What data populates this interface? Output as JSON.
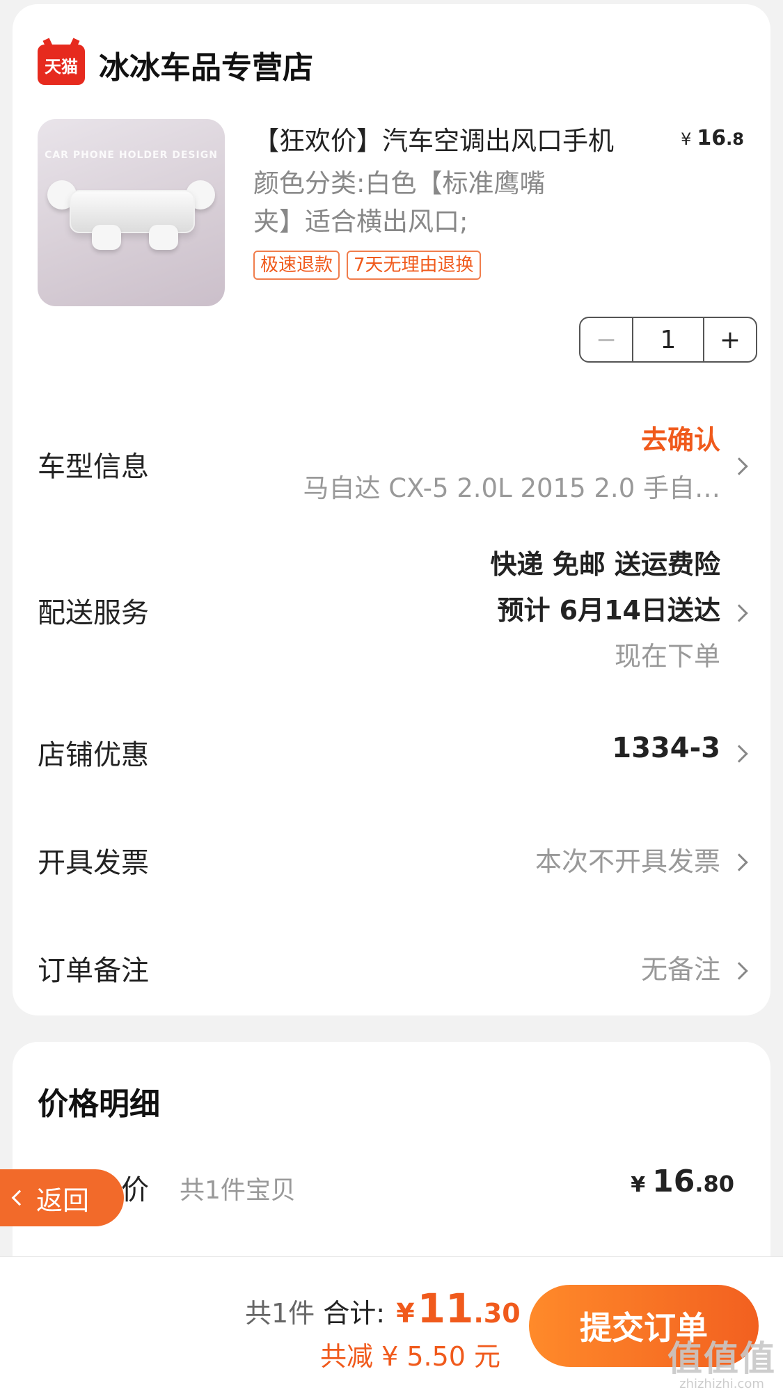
{
  "store": {
    "logo_text": "天猫",
    "name": "冰冰车品专营店"
  },
  "product": {
    "image_tagline": "CAR PHONE HOLDER DESIGN",
    "title": "【狂欢价】汽车空调出风口手机",
    "price_symbol": "¥",
    "price_int": "16",
    "price_dec": ".8",
    "spec_line1": "颜色分类:白色【标准鹰嘴",
    "spec_line2": "夹】适合横出风口;",
    "tags": [
      "极速退款",
      "7天无理由退换"
    ],
    "quantity": "1",
    "minus": "−",
    "plus": "+"
  },
  "rows": {
    "car": {
      "label": "车型信息",
      "action": "去确认",
      "value": "马自达 CX-5 2.0L 2015 2.0 手自…"
    },
    "delivery": {
      "label": "配送服务",
      "line1": "快递 免邮 送运费险",
      "line2": "预计 6月14日送达",
      "line3": "现在下单"
    },
    "coupon": {
      "label": "店铺优惠",
      "value": "1334-3"
    },
    "invoice": {
      "label": "开具发票",
      "value": "本次不开具发票"
    },
    "note": {
      "label": "订单备注",
      "value": "无备注"
    }
  },
  "price_detail": {
    "title": "价格明细",
    "goods_label": "商品总价",
    "goods_count": "共1件宝贝",
    "symbol": "¥",
    "goods_int": "16",
    "goods_dec": ".80"
  },
  "footer": {
    "count": "共1件",
    "total_label": "合计:",
    "symbol": "¥",
    "total_int": "11",
    "total_dec": ".30",
    "savings": "共减 ¥ 5.50 元",
    "submit": "提交订单"
  },
  "back": {
    "label": "返回"
  },
  "watermark": {
    "big": "值值值",
    "small": "zhizhizhi.com"
  },
  "colors": {
    "accent": "#f05a1c",
    "tmall_red": "#e62a1e",
    "button": "#f26020"
  }
}
